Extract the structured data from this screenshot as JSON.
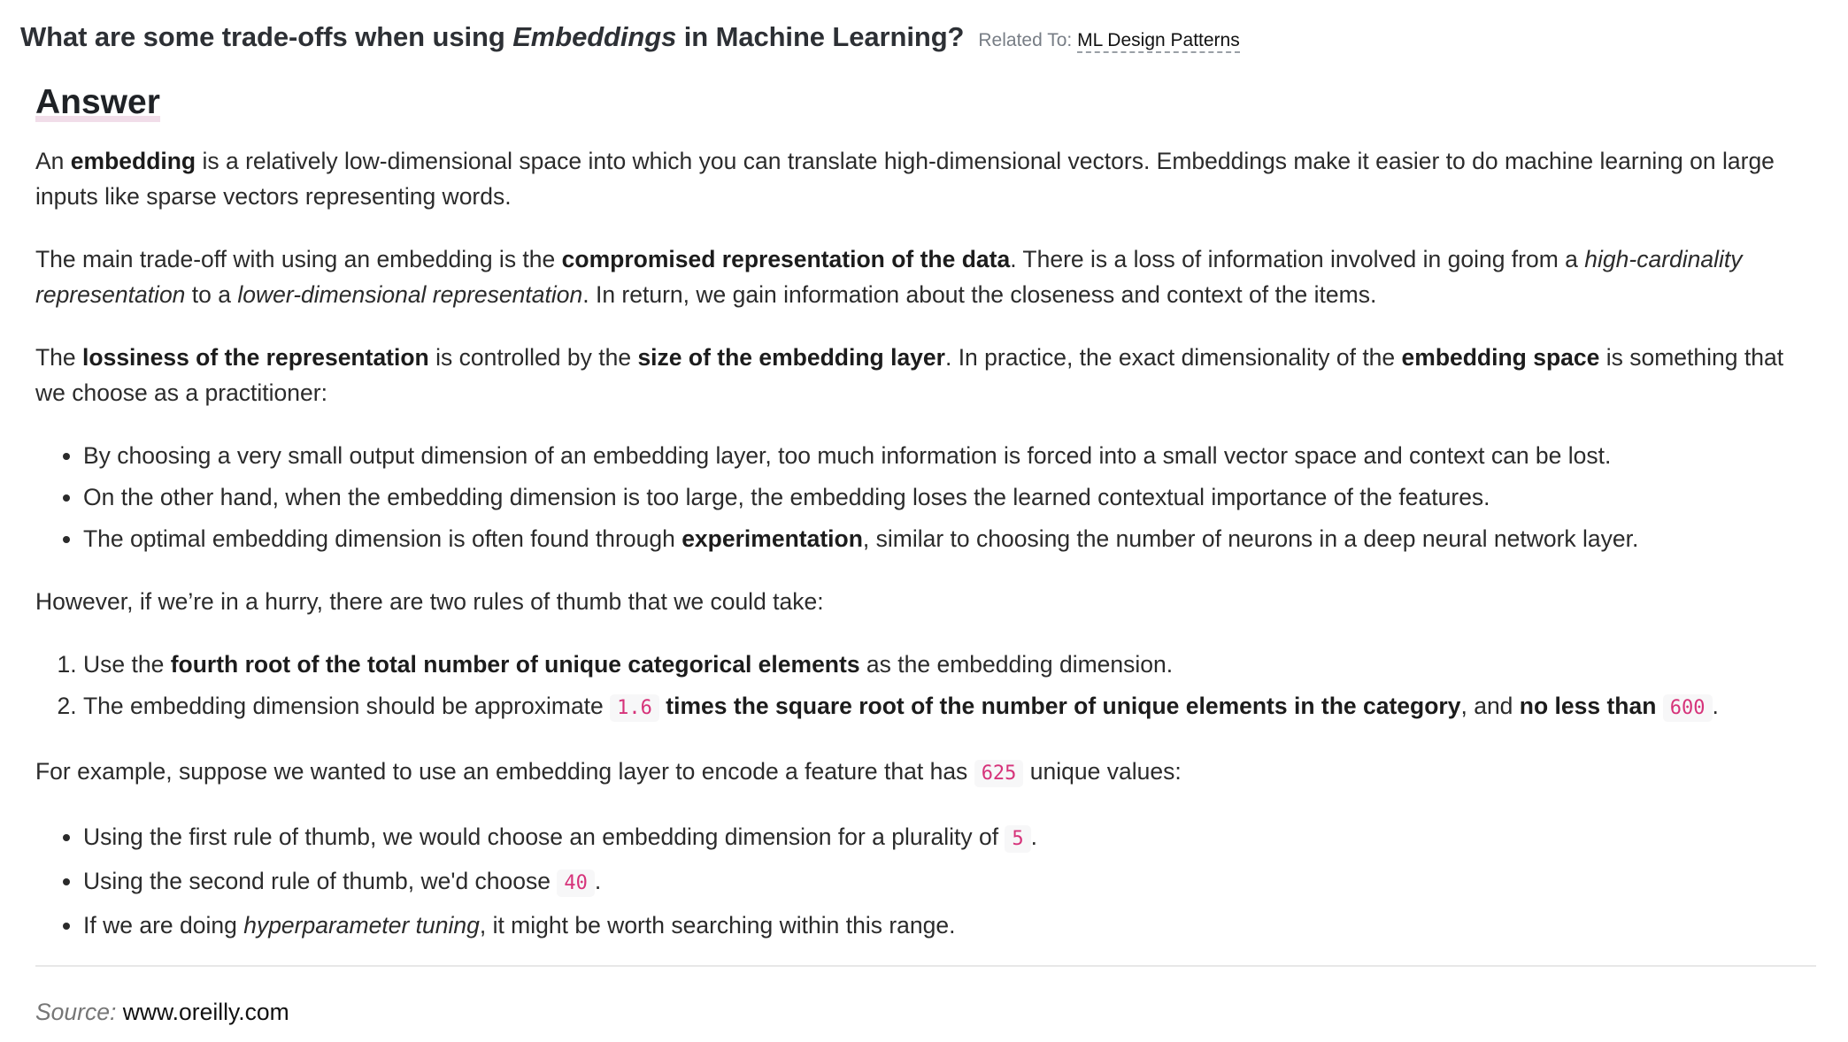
{
  "header": {
    "title_prefix": "What are some trade-offs when using ",
    "title_emphasis": "Embeddings",
    "title_suffix": " in Machine Learning?",
    "related_label": "Related To:",
    "related_link": "ML Design Patterns"
  },
  "answer": {
    "heading": "Answer",
    "p1": {
      "t1": "An ",
      "b1": "embedding",
      "t2": " is a relatively low-dimensional space into which you can translate high-dimensional vectors. Embeddings make it easier to do machine learning on large inputs like sparse vectors representing words."
    },
    "p2": {
      "t1": "The main trade-off with using an embedding is the ",
      "b1": "compromised representation of the data",
      "t2": ". There is a loss of information involved in going from a ",
      "i1": "high-cardinality representation",
      "t3": " to a ",
      "i2": "lower-dimensional representation",
      "t4": ". In return, we gain information about the closeness and context of the items."
    },
    "p3": {
      "t1": "The ",
      "b1": "lossiness of the representation",
      "t2": " is controlled by the ",
      "b2": "size of the embedding layer",
      "t3": ". In practice, the exact dimensionality of the ",
      "b3": "embedding space",
      "t4": " is something that we choose as a practitioner:"
    },
    "bullets1": {
      "item1": "By choosing a very small output dimension of an embedding layer, too much information is forced into a small vector space and context can be lost.",
      "item2": "On the other hand, when the embedding dimension is too large, the embedding loses the learned contextual importance of the features.",
      "item3_t1": "The optimal embedding dimension is often found through ",
      "item3_b1": "experimentation",
      "item3_t2": ", similar to choosing the number of neurons in a deep neural network layer."
    },
    "p4": "However, if we’re in a hurry, there are two rules of thumb that we could take:",
    "rules": {
      "r1_t1": "Use the ",
      "r1_b1": "fourth root of the total number of unique categorical elements",
      "r1_t2": " as the embedding dimension.",
      "r2_t1": "The embedding dimension should be approximate ",
      "r2_c1": "1.6",
      "r2_b1": "times the square root of the number of unique elements in the category",
      "r2_t2": ", and ",
      "r2_b2": "no less than",
      "r2_c2": "600",
      "r2_t3": "."
    },
    "p5": {
      "t1": "For example, suppose we wanted to use an embedding layer to encode a feature that has ",
      "c1": "625",
      "t2": " unique values:"
    },
    "bullets2": {
      "item1_t1": "Using the first rule of thumb, we would choose an embedding dimension for a plurality of ",
      "item1_c1": "5",
      "item1_t2": ".",
      "item2_t1": "Using the second rule of thumb, we'd choose ",
      "item2_c1": "40",
      "item2_t2": ".",
      "item3_t1": "If we are doing ",
      "item3_i1": "hyperparameter tuning",
      "item3_t2": ", it might be worth searching within this range."
    }
  },
  "footer": {
    "source_label": "Source:",
    "source_link": "www.oreilly.com"
  }
}
